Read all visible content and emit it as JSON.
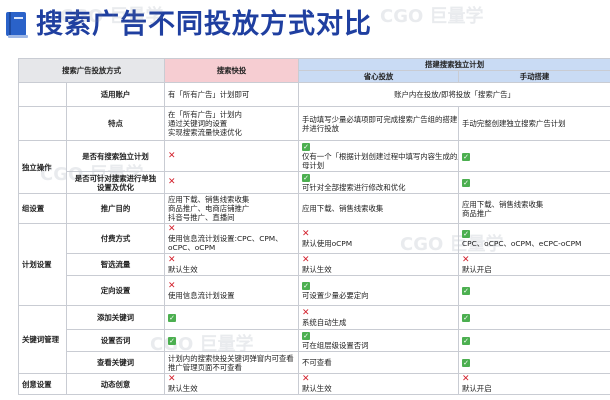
{
  "page": {
    "title": "搜索广告不同投放方式对比",
    "watermark": "CGO 巨量学"
  },
  "table": {
    "headers": {
      "mode": "搜索广告投放方式",
      "quick": "搜索快投",
      "standalone": "搭建搜索独立计划",
      "smart": "省心投放",
      "manual": "手动搭建"
    },
    "rows": [
      {
        "category": "",
        "feature": "适用账户",
        "quick": "有「所有广告」计划即可",
        "merged": "账户内在投放/即将投放「搜索广告」"
      },
      {
        "category": "",
        "feature": "特点",
        "quick": [
          "在「所有广告」计划内",
          "通过关键词的设置",
          "实现搜索流量快速优化"
        ],
        "smart": [
          "手动填写少量必填项即可完成搜索广告组的搭建",
          "并进行投放"
        ],
        "manual": "手动完整创建独立搜索广告计划"
      },
      {
        "category": "独立操作",
        "feature": "是否有搜索独立计划",
        "quick_icon": "cross",
        "smart_icon": "check",
        "smart": [
          "仅有一个「根据计划创建过程中填写内容生成的」",
          "母计划"
        ],
        "manual_icon": "check"
      },
      {
        "category": "",
        "feature": [
          "是否可针对搜索进行单独",
          "设置及优化"
        ],
        "quick_icon": "cross",
        "smart_icon": "check",
        "smart": "可针对全部搜索进行修改和优化",
        "manual_icon": "check"
      },
      {
        "category": "组设置",
        "feature": "推广目的",
        "quick": [
          "应用下载、销售线索收集",
          "商品推广、电商店铺推广",
          "抖音号推广、直播间"
        ],
        "smart": "应用下载、销售线索收集",
        "manual": [
          "应用下载、销售线索收集",
          "商品推广"
        ]
      },
      {
        "category": "计划设置",
        "feature": "付费方式",
        "quick_icon": "cross",
        "quick": [
          "使用信息流计划设置:CPC、CPM、",
          "oCPC、oCPM"
        ],
        "smart_icon": "cross",
        "smart": "默认使用oCPM",
        "manual_icon": "check",
        "manual": "CPC、oCPC、oCPM、eCPC-oCPM"
      },
      {
        "category": "",
        "feature": "智选流量",
        "quick_icon": "cross",
        "quick": "默认生效",
        "smart_icon": "cross",
        "smart": "默认生效",
        "manual_icon": "cross",
        "manual": "默认开启"
      },
      {
        "category": "",
        "feature": "定向设置",
        "quick_icon": "cross",
        "quick": "使用信息流计划设置",
        "smart_icon": "check",
        "smart": "可设置少量必要定向",
        "manual_icon": "check"
      },
      {
        "category": "关键词管理",
        "feature": "添加关键词",
        "quick_icon": "check",
        "smart_icon": "cross",
        "smart": "系统自动生成",
        "manual_icon": "check"
      },
      {
        "category": "",
        "feature": "设置否词",
        "quick_icon": "check",
        "smart_icon": "check",
        "smart": "可在组层级设置否词",
        "manual_icon": "check"
      },
      {
        "category": "",
        "feature": "查看关键词",
        "quick": [
          "计划内的搜索快投关键词弹窗内可查看",
          "推广管理页面不可查看"
        ],
        "smart": "不可查看",
        "manual_icon": "check"
      },
      {
        "category": "创意设置",
        "feature": "动态创意",
        "quick_icon": "cross",
        "quick": "默认生效",
        "smart_icon": "cross",
        "smart": "默认生效",
        "manual_icon": "cross",
        "manual": "默认开启"
      }
    ]
  }
}
